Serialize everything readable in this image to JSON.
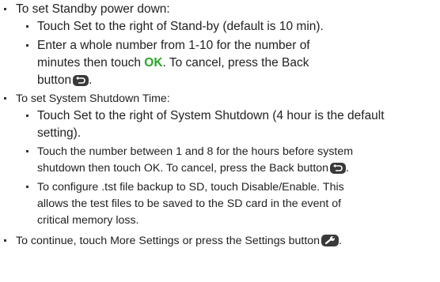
{
  "items": {
    "standby_heading": "To set Standby power down:",
    "standby_1": "Touch Set to the right of Stand-by (default is 10 min).",
    "standby_2_a": "Enter a whole number from 1-10 for the number of",
    "standby_2_b": "minutes then touch ",
    "standby_2_ok": "OK",
    "standby_2_c": ". To cancel, press the Back",
    "standby_2_d": "button",
    "standby_2_e": ".",
    "shutdown_heading": "To set System Shutdown Time:",
    "shutdown_1_a": "Touch Set to the right of System Shutdown (4 hour is the default",
    "shutdown_1_b": "setting).",
    "shutdown_2_a": "Touch the number between 1 and 8 for the hours before system",
    "shutdown_2_b": "shutdown then touch OK. To cancel, press the Back button",
    "shutdown_2_c": ".",
    "shutdown_3_a": "To configure .tst file backup to SD, touch Disable/Enable. This",
    "shutdown_3_b": "allows the test files to be saved to the SD card in the event of",
    "shutdown_3_c": "critical memory loss.",
    "continue_a": "To continue, touch More Settings or press the Settings button",
    "continue_b": "."
  },
  "icons": {
    "back": "back-button-icon",
    "settings": "settings-wrench-icon"
  },
  "colors": {
    "text": "#222222",
    "ok": "#2aa52a",
    "icon_bg": "#3a3a3a",
    "icon_fg": "#ffffff"
  }
}
